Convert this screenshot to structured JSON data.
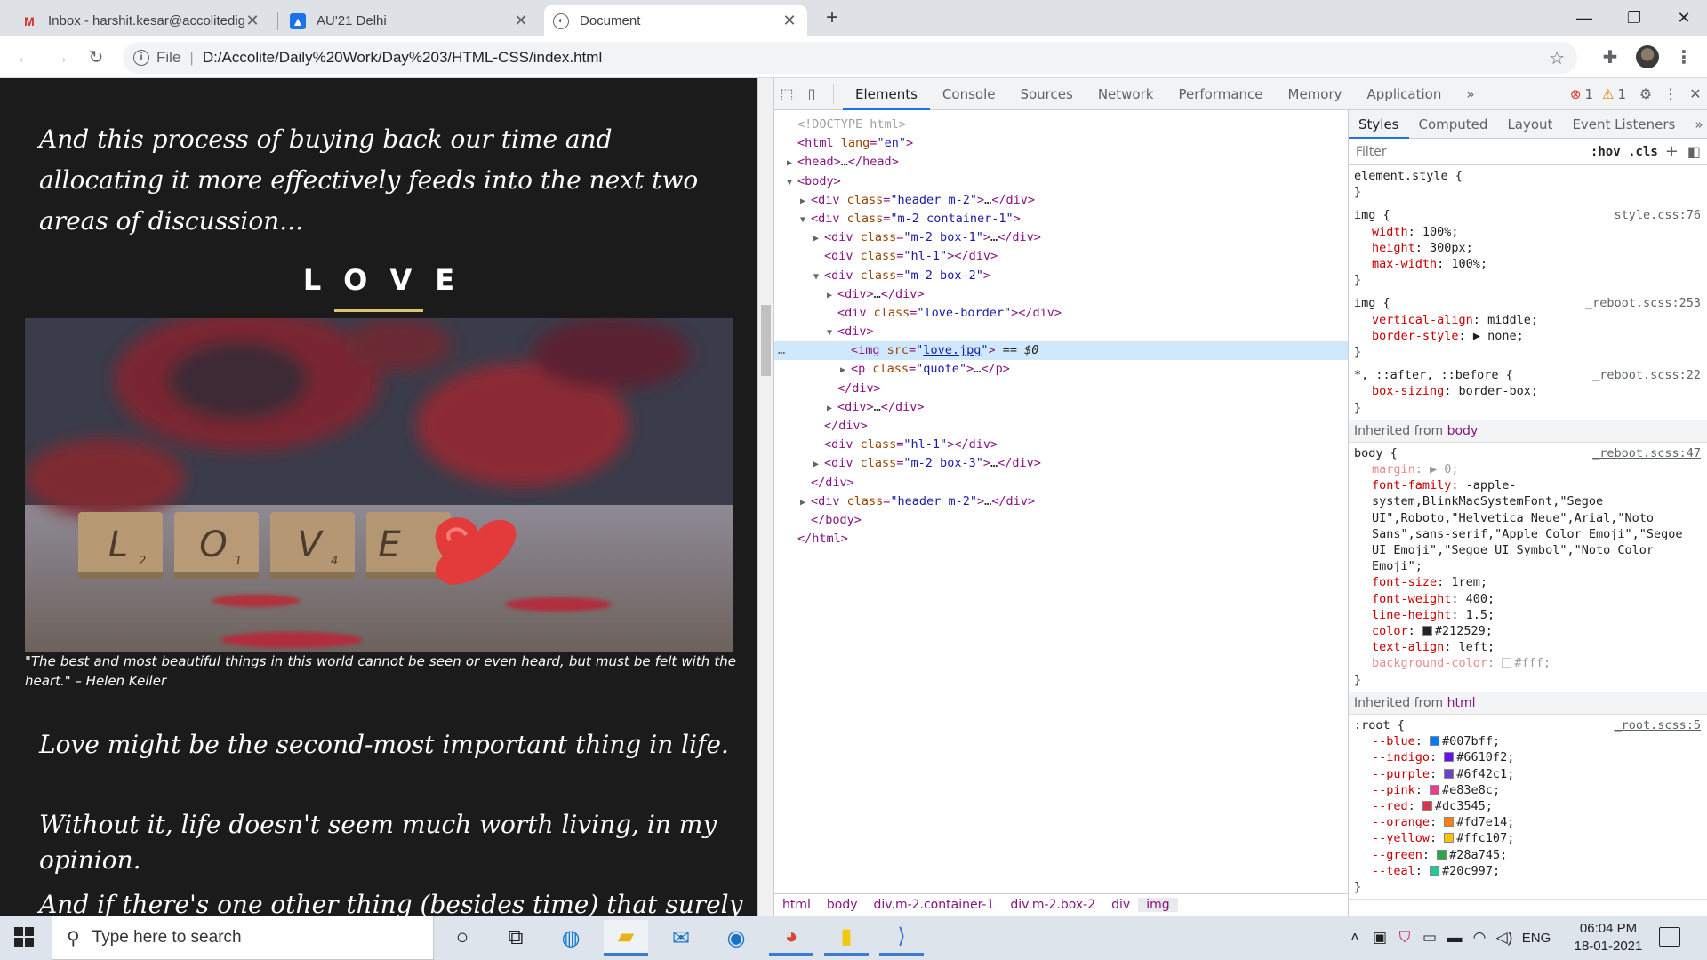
{
  "browser": {
    "tabs": [
      {
        "title": "Inbox - harshit.kesar@accolitedig",
        "icon": "gmail-icon"
      },
      {
        "title": "AU'21 Delhi",
        "icon": "contacts-icon"
      },
      {
        "title": "Document",
        "icon": "globe-icon"
      }
    ],
    "address": {
      "scheme_label": "File",
      "url": "D:/Accolite/Daily%20Work/Day%203/HTML-CSS/index.html"
    }
  },
  "page": {
    "lead": "And this process of buying back our time and allocating it more effectively feeds into the next two areas of discussion...",
    "love_title": "LOVE",
    "image_tiles": [
      "L",
      "O",
      "V",
      "E"
    ],
    "image_subscripts": [
      "2",
      "1",
      "4",
      ""
    ],
    "quote": "\"The best and most beautiful things in this world cannot be seen or even heard, but must be felt with the heart.\" – Helen Keller",
    "para1": "Love might be the second-most important thing in life.",
    "para2": "Without it, life doesn't seem much worth living, in my opinion.",
    "para3": "And if there's one other thing (besides time) that surely cannot be"
  },
  "devtools": {
    "tabs": [
      "Elements",
      "Console",
      "Sources",
      "Network",
      "Performance",
      "Memory",
      "Application"
    ],
    "more": "»",
    "errors": "1",
    "warnings": "1",
    "dom": [
      {
        "indent": 0,
        "tri": "",
        "html": "<span class=\"cm\">&lt;!DOCTYPE html&gt;</span>"
      },
      {
        "indent": 0,
        "tri": "",
        "html": "&lt;html <span class=\"attr\">lang</span>=<span class=\"val\">\"en\"</span>&gt;"
      },
      {
        "indent": 0,
        "tri": "▶",
        "html": "&lt;head&gt;<span class=\"txt\">…</span>&lt;/head&gt;"
      },
      {
        "indent": 0,
        "tri": "▼",
        "html": "&lt;body&gt;"
      },
      {
        "indent": 1,
        "tri": "▶",
        "html": "&lt;div <span class=\"attr\">class</span>=<span class=\"val\">\"header m-2\"</span>&gt;<span class=\"txt\">…</span>&lt;/div&gt;"
      },
      {
        "indent": 1,
        "tri": "▼",
        "html": "&lt;div <span class=\"attr\">class</span>=<span class=\"val\">\"m-2 container-1\"</span>&gt;"
      },
      {
        "indent": 2,
        "tri": "▶",
        "html": "&lt;div <span class=\"attr\">class</span>=<span class=\"val\">\"m-2 box-1\"</span>&gt;<span class=\"txt\">…</span>&lt;/div&gt;"
      },
      {
        "indent": 2,
        "tri": "",
        "html": "&lt;div <span class=\"attr\">class</span>=<span class=\"val\">\"hl-1\"</span>&gt;&lt;/div&gt;"
      },
      {
        "indent": 2,
        "tri": "▼",
        "html": "&lt;div <span class=\"attr\">class</span>=<span class=\"val\">\"m-2 box-2\"</span>&gt;"
      },
      {
        "indent": 3,
        "tri": "▶",
        "html": "&lt;div&gt;<span class=\"txt\">…</span>&lt;/div&gt;"
      },
      {
        "indent": 3,
        "tri": "",
        "html": "&lt;div <span class=\"attr\">class</span>=<span class=\"val\">\"love-border\"</span>&gt;&lt;/div&gt;"
      },
      {
        "indent": 3,
        "tri": "▼",
        "html": "&lt;div&gt;"
      },
      {
        "indent": 4,
        "tri": "",
        "html": "&lt;img <span class=\"attr\">src</span>=<span class=\"val\">\"<u>love.jpg</u>\"</span>&gt; <span class=\"txt\">== <i>$0</i></span>",
        "selected": true
      },
      {
        "indent": 4,
        "tri": "▶",
        "html": "&lt;p <span class=\"attr\">class</span>=<span class=\"val\">\"quote\"</span>&gt;<span class=\"txt\">…</span>&lt;/p&gt;"
      },
      {
        "indent": 3,
        "tri": "",
        "html": "&lt;/div&gt;"
      },
      {
        "indent": 3,
        "tri": "▶",
        "html": "&lt;div&gt;<span class=\"txt\">…</span>&lt;/div&gt;"
      },
      {
        "indent": 2,
        "tri": "",
        "html": "&lt;/div&gt;"
      },
      {
        "indent": 2,
        "tri": "",
        "html": "&lt;div <span class=\"attr\">class</span>=<span class=\"val\">\"hl-1\"</span>&gt;&lt;/div&gt;"
      },
      {
        "indent": 2,
        "tri": "▶",
        "html": "&lt;div <span class=\"attr\">class</span>=<span class=\"val\">\"m-2 box-3\"</span>&gt;<span class=\"txt\">…</span>&lt;/div&gt;"
      },
      {
        "indent": 1,
        "tri": "",
        "html": "&lt;/div&gt;"
      },
      {
        "indent": 1,
        "tri": "▶",
        "html": "&lt;div <span class=\"attr\">class</span>=<span class=\"val\">\"header m-2\"</span>&gt;<span class=\"txt\">…</span>&lt;/div&gt;"
      },
      {
        "indent": 1,
        "tri": "",
        "html": "&lt;/body&gt;"
      },
      {
        "indent": 0,
        "tri": "",
        "html": "&lt;/html&gt;"
      }
    ],
    "breadcrumbs": [
      "html",
      "body",
      "div.m-2.container-1",
      "div.m-2.box-2",
      "div",
      "img"
    ],
    "styles_tabs": [
      "Styles",
      "Computed",
      "Layout",
      "Event Listeners"
    ],
    "filter_placeholder": "Filter",
    "hov_cls": ":hov  .cls",
    "rules": [
      {
        "selector": "element.style {",
        "source": "",
        "props": []
      },
      {
        "selector": "img {",
        "source": "style.css:76",
        "props": [
          {
            "n": "width",
            "v": "100%;"
          },
          {
            "n": "height",
            "v": "300px;"
          },
          {
            "n": "max-width",
            "v": "100%;"
          }
        ]
      },
      {
        "selector": "img {",
        "source": "_reboot.scss:253",
        "props": [
          {
            "n": "vertical-align",
            "v": "middle;"
          },
          {
            "n": "border-style",
            "v": "▶ none;"
          }
        ]
      },
      {
        "selector": "*, ::after, ::before {",
        "source": "_reboot.scss:22",
        "props": [
          {
            "n": "box-sizing",
            "v": "border-box;"
          }
        ]
      }
    ],
    "inherited_body_label": "Inherited from",
    "inherited_body_tag": "body",
    "body_rule": {
      "selector": "body {",
      "source": "_reboot.scss:47",
      "props": [
        {
          "n": "margin",
          "v": "▶ 0;",
          "faded": true
        },
        {
          "n": "font-family",
          "v": "-apple-system,BlinkMacSystemFont,\"Segoe UI\",Roboto,\"Helvetica Neue\",Arial,\"Noto Sans\",sans-serif,\"Apple Color Emoji\",\"Segoe UI Emoji\",\"Segoe UI Symbol\",\"Noto Color Emoji\";"
        },
        {
          "n": "font-size",
          "v": "1rem;"
        },
        {
          "n": "font-weight",
          "v": "400;"
        },
        {
          "n": "line-height",
          "v": "1.5;"
        },
        {
          "n": "color",
          "v": "#212529;",
          "swatch": "#212529"
        },
        {
          "n": "text-align",
          "v": "left;"
        },
        {
          "n": "background-color",
          "v": "#fff;",
          "swatch": "#ffffff",
          "faded": true
        }
      ]
    },
    "inherited_html_tag": "html",
    "root_rule": {
      "selector": ":root {",
      "source": "_root.scss:5",
      "props": [
        {
          "n": "--blue",
          "v": "#007bff;",
          "swatch": "#007bff"
        },
        {
          "n": "--indigo",
          "v": "#6610f2;",
          "swatch": "#6610f2"
        },
        {
          "n": "--purple",
          "v": "#6f42c1;",
          "swatch": "#6f42c1"
        },
        {
          "n": "--pink",
          "v": "#e83e8c;",
          "swatch": "#e83e8c"
        },
        {
          "n": "--red",
          "v": "#dc3545;",
          "swatch": "#dc3545"
        },
        {
          "n": "--orange",
          "v": "#fd7e14;",
          "swatch": "#fd7e14"
        },
        {
          "n": "--yellow",
          "v": "#ffc107;",
          "swatch": "#ffc107"
        },
        {
          "n": "--green",
          "v": "#28a745;",
          "swatch": "#28a745"
        },
        {
          "n": "--teal",
          "v": "#20c997;",
          "swatch": "#20c997"
        }
      ]
    }
  },
  "taskbar": {
    "search_placeholder": "Type here to search",
    "language": "ENG",
    "time": "06:04 PM",
    "date": "18-01-2021"
  }
}
